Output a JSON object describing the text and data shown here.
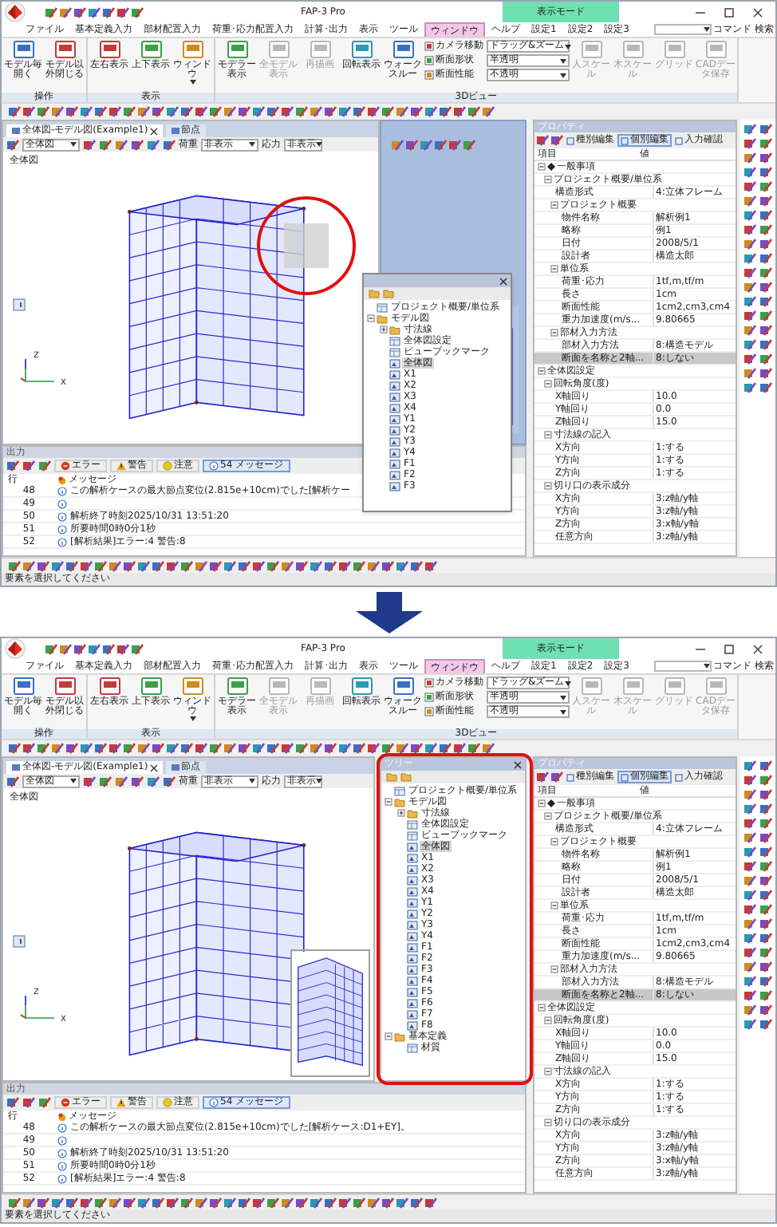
{
  "screens": [
    {
      "title_bar": {
        "title": "FAP-3 Pro",
        "mode_tab": "表示モード"
      },
      "menu_tabs": [
        {
          "label": "ファイル",
          "selected": false
        },
        {
          "label": "基本定義入力",
          "selected": false
        },
        {
          "label": "部材配置入力",
          "selected": false
        },
        {
          "label": "荷重･応力配置入力",
          "selected": false
        },
        {
          "label": "計算･出力",
          "selected": false
        },
        {
          "label": "表示",
          "selected": false
        },
        {
          "label": "ツール",
          "selected": false
        },
        {
          "label": "ウィンドウ",
          "selected": true
        },
        {
          "label": "ヘルプ",
          "selected": false
        },
        {
          "label": "設定1",
          "selected": false
        },
        {
          "label": "設定2",
          "selected": false
        },
        {
          "label": "設定3",
          "selected": false
        }
      ],
      "command_search": "コマンド 検索",
      "ribbon_groups": [
        {
          "label": "操作",
          "buttons": [
            {
              "kind": "large",
              "label": "モデル毎開く",
              "disabled": false
            },
            {
              "kind": "large",
              "label": "モデル以外閉じる",
              "disabled": false
            }
          ]
        },
        {
          "label": "表示",
          "buttons": [
            {
              "kind": "large",
              "label": "左右表示",
              "disabled": false
            },
            {
              "kind": "large",
              "label": "上下表示",
              "disabled": false
            },
            {
              "kind": "menu",
              "label": "ウィンドウ",
              "disabled": false
            }
          ]
        },
        {
          "label": "3Dビュー",
          "buttons": [
            {
              "kind": "large",
              "label": "モデラー表示",
              "disabled": false
            },
            {
              "kind": "large",
              "label": "全モデル表示",
              "disabled": true
            },
            {
              "kind": "large",
              "label": "再描画",
              "disabled": true
            },
            {
              "kind": "large",
              "label": "回転表示",
              "disabled": false
            },
            {
              "kind": "large",
              "label": "ウォークスルー",
              "disabled": false
            },
            {
              "kind": "option",
              "label": "カメラ移動",
              "value": "ドラッグ&ズーム",
              "disabled": false
            },
            {
              "kind": "option",
              "label": "断面形状",
              "value": "半透明",
              "disabled": false
            },
            {
              "kind": "option",
              "label": "断面性能",
              "value": "不透明",
              "disabled": false
            },
            {
              "kind": "large",
              "label": "人スケール",
              "disabled": true
            },
            {
              "kind": "large",
              "label": "木スケール",
              "disabled": true
            },
            {
              "kind": "large",
              "label": "グリッド",
              "disabled": true
            },
            {
              "kind": "large",
              "label": "CADデータ保存",
              "disabled": true
            }
          ]
        }
      ],
      "doc_tabs": [
        {
          "label": "全体図-モデル図(Example1)",
          "selected": true
        },
        {
          "label": "節点",
          "selected": false
        }
      ],
      "view_toolbar": {
        "view": "全体図",
        "load_label": "荷重",
        "load_value": "非表示",
        "stress_label": "応力",
        "stress_value": "非表示"
      },
      "canvas": {
        "label": "全体図",
        "axis_labels": [
          "Z",
          "X"
        ]
      },
      "tree_panel": {
        "docked": false,
        "items": [
          {
            "kind": "doc",
            "label": "プロジェクト概要/単位系",
            "selected": false
          },
          {
            "kind": "folder",
            "label": "モデル図",
            "selected": false,
            "expanded": true,
            "children": [
              {
                "kind": "folder",
                "label": "寸法線",
                "selected": false,
                "expanded": false
              },
              {
                "kind": "doc",
                "label": "全体図設定",
                "selected": false
              },
              {
                "kind": "doc",
                "label": "ビューブックマーク",
                "selected": false
              },
              {
                "kind": "view",
                "label": "全体図",
                "selected": true
              },
              {
                "kind": "view",
                "label": "X1",
                "selected": false
              },
              {
                "kind": "view",
                "label": "X2",
                "selected": false
              },
              {
                "kind": "view",
                "label": "X3",
                "selected": false
              },
              {
                "kind": "view",
                "label": "X4",
                "selected": false
              },
              {
                "kind": "view",
                "label": "Y1",
                "selected": false
              },
              {
                "kind": "view",
                "label": "Y2",
                "selected": false
              },
              {
                "kind": "view",
                "label": "Y3",
                "selected": false
              },
              {
                "kind": "view",
                "label": "Y4",
                "selected": false
              },
              {
                "kind": "view",
                "label": "F1",
                "selected": false
              },
              {
                "kind": "view",
                "label": "F2",
                "selected": false
              },
              {
                "kind": "view",
                "label": "F3",
                "selected": false
              }
            ]
          }
        ]
      },
      "annotation": {
        "kind": "circle"
      },
      "properties": {
        "title": "プロパティ",
        "tabs": [
          {
            "label": "種別編集",
            "selected": false
          },
          {
            "label": "個別編集",
            "selected": true
          },
          {
            "label": "入力確認",
            "selected": false
          }
        ],
        "columns": [
          "項目",
          "値"
        ],
        "rows": [
          {
            "label": "一般事項",
            "selected": false,
            "expanded": true,
            "children": [
              {
                "label": "プロジェクト概要/単位系",
                "selected": false,
                "expanded": true,
                "children": [
                  {
                    "label": "構造形式",
                    "value": "4:立体フレーム",
                    "selected": false
                  },
                  {
                    "label": "プロジェクト概要",
                    "selected": false,
                    "expanded": true,
                    "children": [
                      {
                        "label": "物件名称",
                        "value": "解析例1",
                        "selected": false
                      },
                      {
                        "label": "略称",
                        "value": "例1",
                        "selected": false
                      },
                      {
                        "label": "日付",
                        "value": "2008/5/1",
                        "selected": false
                      },
                      {
                        "label": "設計者",
                        "value": "構造太郎",
                        "selected": false
                      }
                    ]
                  },
                  {
                    "label": "単位系",
                    "selected": false,
                    "expanded": true,
                    "children": [
                      {
                        "label": "荷重･応力",
                        "value": "1tf,m,tf/m",
                        "selected": false
                      },
                      {
                        "label": "長さ",
                        "value": "1cm",
                        "selected": false
                      },
                      {
                        "label": "断面性能",
                        "value": "1cm2,cm3,cm4",
                        "selected": false
                      },
                      {
                        "label": "重力加速度(m/s...",
                        "value": "9.80665",
                        "selected": false
                      }
                    ]
                  },
                  {
                    "label": "部材入力方法",
                    "selected": false,
                    "expanded": true,
                    "children": [
                      {
                        "label": "部材入力方法",
                        "value": "8:構造モデル",
                        "selected": false
                      },
                      {
                        "label": "断面を名称と2軸...",
                        "value": "8:しない",
                        "selected": true
                      }
                    ]
                  }
                ]
              }
            ]
          },
          {
            "label": "全体図設定",
            "selected": false,
            "expanded": true,
            "children": [
              {
                "label": "回転角度(度)",
                "selected": false,
                "expanded": true,
                "children": [
                  {
                    "label": "X軸回り",
                    "value": "10.0",
                    "selected": false
                  },
                  {
                    "label": "Y軸回り",
                    "value": "0.0",
                    "selected": false
                  },
                  {
                    "label": "Z軸回り",
                    "value": "15.0",
                    "selected": false
                  }
                ]
              },
              {
                "label": "寸法線の記入",
                "selected": false,
                "expanded": true,
                "children": [
                  {
                    "label": "X方向",
                    "value": "1:する",
                    "selected": false
                  },
                  {
                    "label": "Y方向",
                    "value": "1:する",
                    "selected": false
                  },
                  {
                    "label": "Z方向",
                    "value": "1:する",
                    "selected": false
                  }
                ]
              },
              {
                "label": "切り口の表示成分",
                "selected": false,
                "expanded": true,
                "children": [
                  {
                    "label": "X方向",
                    "value": "3:z軸/y軸",
                    "selected": false
                  },
                  {
                    "label": "Y方向",
                    "value": "3:z軸/y軸",
                    "selected": false
                  },
                  {
                    "label": "Z方向",
                    "value": "3:x軸/y軸",
                    "selected": false
                  },
                  {
                    "label": "任意方向",
                    "value": "3:z軸/y軸",
                    "selected": false
                  }
                ]
              }
            ]
          }
        ]
      },
      "output": {
        "title": "出力",
        "tabs": [
          {
            "kind": "error",
            "label": "エラー",
            "selected": false
          },
          {
            "kind": "warning",
            "label": "警告",
            "selected": false
          },
          {
            "kind": "note",
            "label": "注意",
            "selected": false
          },
          {
            "kind": "info",
            "label": "54 メッセージ",
            "selected": true
          }
        ],
        "columns": [
          "行",
          "メッセージ"
        ],
        "rows": [
          {
            "line": "48",
            "text": "この解析ケースの最大節点変位(2.815e+10cm)でした[解析ケー"
          },
          {
            "line": "49"
          },
          {
            "line": "50",
            "text": "解析終了時刻2025/10/31 13:51:20"
          },
          {
            "line": "51",
            "text": "所要時間0時0分1秒"
          },
          {
            "line": "52",
            "text": "[解析結果]エラー:4 警告:8"
          }
        ]
      },
      "status": "要素を選択してください"
    },
    {
      "title_bar": {
        "title": "FAP-3 Pro",
        "mode_tab": "表示モード"
      },
      "menu_tabs": [
        {
          "label": "ファイル",
          "selected": false
        },
        {
          "label": "基本定義入力",
          "selected": false
        },
        {
          "label": "部材配置入力",
          "selected": false
        },
        {
          "label": "荷重･応力配置入力",
          "selected": false
        },
        {
          "label": "計算･出力",
          "selected": false
        },
        {
          "label": "表示",
          "selected": false
        },
        {
          "label": "ツール",
          "selected": false
        },
        {
          "label": "ウィンドウ",
          "selected": true
        },
        {
          "label": "ヘルプ",
          "selected": false
        },
        {
          "label": "設定1",
          "selected": false
        },
        {
          "label": "設定2",
          "selected": false
        },
        {
          "label": "設定3",
          "selected": false
        }
      ],
      "command_search": "コマンド 検索",
      "ribbon_groups": [
        {
          "label": "操作",
          "buttons": [
            {
              "kind": "large",
              "label": "モデル毎開く",
              "disabled": false
            },
            {
              "kind": "large",
              "label": "モデル以外閉じる",
              "disabled": false
            }
          ]
        },
        {
          "label": "表示",
          "buttons": [
            {
              "kind": "large",
              "label": "左右表示",
              "disabled": false
            },
            {
              "kind": "large",
              "label": "上下表示",
              "disabled": false
            },
            {
              "kind": "menu",
              "label": "ウィンドウ",
              "disabled": false
            }
          ]
        },
        {
          "label": "3Dビュー",
          "buttons": [
            {
              "kind": "large",
              "label": "モデラー表示",
              "disabled": false
            },
            {
              "kind": "large",
              "label": "全モデル表示",
              "disabled": true
            },
            {
              "kind": "large",
              "label": "再描画",
              "disabled": true
            },
            {
              "kind": "large",
              "label": "回転表示",
              "disabled": false
            },
            {
              "kind": "large",
              "label": "ウォークスルー",
              "disabled": false
            },
            {
              "kind": "option",
              "label": "カメラ移動",
              "value": "ドラッグ&ズーム",
              "disabled": false
            },
            {
              "kind": "option",
              "label": "断面形状",
              "value": "半透明",
              "disabled": false
            },
            {
              "kind": "option",
              "label": "断面性能",
              "value": "不透明",
              "disabled": false
            },
            {
              "kind": "large",
              "label": "人スケール",
              "disabled": true
            },
            {
              "kind": "large",
              "label": "木スケール",
              "disabled": true
            },
            {
              "kind": "large",
              "label": "グリッド",
              "disabled": true
            },
            {
              "kind": "large",
              "label": "CADデータ保存",
              "disabled": true
            }
          ]
        }
      ],
      "doc_tabs": [
        {
          "label": "全体図-モデル図(Example1)",
          "selected": true
        },
        {
          "label": "節点",
          "selected": false
        }
      ],
      "view_toolbar": {
        "view": "全体図",
        "load_label": "荷重",
        "load_value": "非表示",
        "stress_label": "応力",
        "stress_value": "非表示"
      },
      "canvas": {
        "label": "全体図",
        "axis_labels": [
          "Z",
          "X"
        ]
      },
      "tree_panel": {
        "docked": true,
        "title": "ツリー",
        "items": [
          {
            "kind": "doc",
            "label": "プロジェクト概要/単位系",
            "selected": false
          },
          {
            "kind": "folder",
            "label": "モデル図",
            "selected": false,
            "expanded": true,
            "children": [
              {
                "kind": "folder",
                "label": "寸法線",
                "selected": false,
                "expanded": false
              },
              {
                "kind": "doc",
                "label": "全体図設定",
                "selected": false
              },
              {
                "kind": "doc",
                "label": "ビューブックマーク",
                "selected": false
              },
              {
                "kind": "view",
                "label": "全体図",
                "selected": true
              },
              {
                "kind": "view",
                "label": "X1",
                "selected": false
              },
              {
                "kind": "view",
                "label": "X2",
                "selected": false
              },
              {
                "kind": "view",
                "label": "X3",
                "selected": false
              },
              {
                "kind": "view",
                "label": "X4",
                "selected": false
              },
              {
                "kind": "view",
                "label": "Y1",
                "selected": false
              },
              {
                "kind": "view",
                "label": "Y2",
                "selected": false
              },
              {
                "kind": "view",
                "label": "Y3",
                "selected": false
              },
              {
                "kind": "view",
                "label": "Y4",
                "selected": false
              },
              {
                "kind": "view",
                "label": "F1",
                "selected": false
              },
              {
                "kind": "view",
                "label": "F2",
                "selected": false
              },
              {
                "kind": "view",
                "label": "F3",
                "selected": false
              },
              {
                "kind": "view",
                "label": "F4",
                "selected": false
              },
              {
                "kind": "view",
                "label": "F5",
                "selected": false
              },
              {
                "kind": "view",
                "label": "F6",
                "selected": false
              },
              {
                "kind": "view",
                "label": "F7",
                "selected": false
              },
              {
                "kind": "view",
                "label": "F8",
                "selected": false
              }
            ]
          },
          {
            "kind": "folder",
            "label": "基本定義",
            "selected": false,
            "expanded": true,
            "children": [
              {
                "kind": "doc",
                "label": "材質",
                "selected": false
              }
            ]
          }
        ]
      },
      "annotation": {
        "kind": "rounded-rect"
      },
      "properties": {
        "title": "プロパティ",
        "tabs": [
          {
            "label": "種別編集",
            "selected": false
          },
          {
            "label": "個別編集",
            "selected": true
          },
          {
            "label": "入力確認",
            "selected": false
          }
        ],
        "columns": [
          "項目",
          "値"
        ],
        "rows": [
          {
            "label": "一般事項",
            "selected": false,
            "expanded": true,
            "children": [
              {
                "label": "プロジェクト概要/単位系",
                "selected": false,
                "expanded": true,
                "children": [
                  {
                    "label": "構造形式",
                    "value": "4:立体フレーム",
                    "selected": false
                  },
                  {
                    "label": "プロジェクト概要",
                    "selected": false,
                    "expanded": true,
                    "children": [
                      {
                        "label": "物件名称",
                        "value": "解析例1",
                        "selected": false
                      },
                      {
                        "label": "略称",
                        "value": "例1",
                        "selected": false
                      },
                      {
                        "label": "日付",
                        "value": "2008/5/1",
                        "selected": false
                      },
                      {
                        "label": "設計者",
                        "value": "構造太郎",
                        "selected": false
                      }
                    ]
                  },
                  {
                    "label": "単位系",
                    "selected": false,
                    "expanded": true,
                    "children": [
                      {
                        "label": "荷重･応力",
                        "value": "1tf,m,tf/m",
                        "selected": false
                      },
                      {
                        "label": "長さ",
                        "value": "1cm",
                        "selected": false
                      },
                      {
                        "label": "断面性能",
                        "value": "1cm2,cm3,cm4",
                        "selected": false
                      },
                      {
                        "label": "重力加速度(m/s...",
                        "value": "9.80665",
                        "selected": false
                      }
                    ]
                  },
                  {
                    "label": "部材入力方法",
                    "selected": false,
                    "expanded": true,
                    "children": [
                      {
                        "label": "部材入力方法",
                        "value": "8:構造モデル",
                        "selected": false
                      },
                      {
                        "label": "断面を名称と2軸...",
                        "value": "8:しない",
                        "selected": true
                      }
                    ]
                  }
                ]
              }
            ]
          },
          {
            "label": "全体図設定",
            "selected": false,
            "expanded": true,
            "children": [
              {
                "label": "回転角度(度)",
                "selected": false,
                "expanded": true,
                "children": [
                  {
                    "label": "X軸回り",
                    "value": "10.0",
                    "selected": false
                  },
                  {
                    "label": "Y軸回り",
                    "value": "0.0",
                    "selected": false
                  },
                  {
                    "label": "Z軸回り",
                    "value": "15.0",
                    "selected": false
                  }
                ]
              },
              {
                "label": "寸法線の記入",
                "selected": false,
                "expanded": true,
                "children": [
                  {
                    "label": "X方向",
                    "value": "1:する",
                    "selected": false
                  },
                  {
                    "label": "Y方向",
                    "value": "1:する",
                    "selected": false
                  },
                  {
                    "label": "Z方向",
                    "value": "1:する",
                    "selected": false
                  }
                ]
              },
              {
                "label": "切り口の表示成分",
                "selected": false,
                "expanded": true,
                "children": [
                  {
                    "label": "X方向",
                    "value": "3:z軸/y軸",
                    "selected": false
                  },
                  {
                    "label": "Y方向",
                    "value": "3:z軸/y軸",
                    "selected": false
                  },
                  {
                    "label": "Z方向",
                    "value": "3:x軸/y軸",
                    "selected": false
                  },
                  {
                    "label": "任意方向",
                    "value": "3:z軸/y軸",
                    "selected": false
                  }
                ]
              }
            ]
          }
        ]
      },
      "output": {
        "title": "出力",
        "tabs": [
          {
            "kind": "error",
            "label": "エラー",
            "selected": false
          },
          {
            "kind": "warning",
            "label": "警告",
            "selected": false
          },
          {
            "kind": "note",
            "label": "注意",
            "selected": false
          },
          {
            "kind": "info",
            "label": "54 メッセージ",
            "selected": true
          }
        ],
        "columns": [
          "行",
          "メッセージ"
        ],
        "rows": [
          {
            "line": "48",
            "text": "この解析ケースの最大節点変位(2.815e+10cm)でした[解析ケース:D1+EY]。"
          },
          {
            "line": "49"
          },
          {
            "line": "50",
            "text": "解析終了時刻2025/10/31 13:51:20"
          },
          {
            "line": "51",
            "text": "所要時間0時0分1秒"
          },
          {
            "line": "52",
            "text": "[解析結果]エラー:4 警告:8"
          }
        ]
      },
      "status": "要素を選択してください"
    }
  ]
}
